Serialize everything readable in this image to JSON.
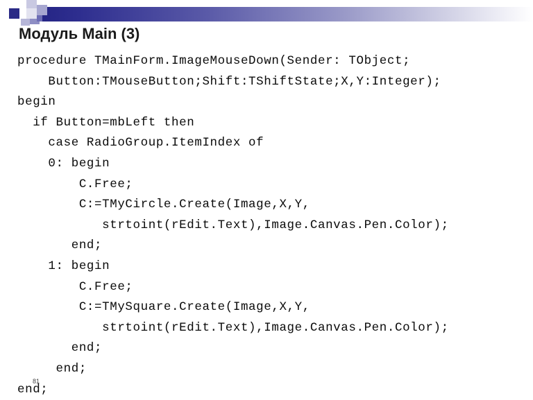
{
  "slide": {
    "title": "Модуль Main (3)",
    "page_number": "81",
    "decoration": {
      "bar_gradient_start": "#252585",
      "bar_gradient_end": "#ffffff",
      "square_dark": "#2a2a86",
      "square_light": "#c9c9e2",
      "square_mid": "#8e8ec4"
    },
    "code": {
      "language": "pascal",
      "lines": [
        "procedure TMainForm.ImageMouseDown(Sender: TObject;",
        "    Button:TMouseButton;Shift:TShiftState;X,Y:Integer);",
        "begin",
        "  if Button=mbLeft then",
        "    case RadioGroup.ItemIndex of",
        "    0: begin",
        "        C.Free;",
        "        C:=TMyCircle.Create(Image,X,Y,",
        "           strtoint(rEdit.Text),Image.Canvas.Pen.Color);",
        "       end;",
        "    1: begin",
        "        C.Free;",
        "        C:=TMySquare.Create(Image,X,Y,",
        "           strtoint(rEdit.Text),Image.Canvas.Pen.Color);",
        "       end;",
        "     end;",
        "end;"
      ]
    }
  }
}
